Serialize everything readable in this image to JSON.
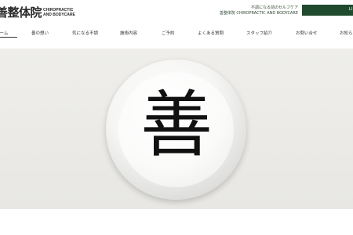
{
  "brand": {
    "name_jp": "善整体院",
    "name_en_line1": "CHIROPRACTIC",
    "name_en_line2": "AND BODYCARE"
  },
  "tagline": {
    "line1": "不調になる前のセルフケア",
    "line2": "善整体院 CHIROPRACTIC AND BODYCARE"
  },
  "cta": {
    "label": "LI"
  },
  "nav": {
    "items": [
      "ホーム",
      "善の想い",
      "気になる不調",
      "施術内容",
      "ご予約",
      "よくある質問",
      "スタッフ紹介",
      "お問い合せ",
      "お知ら"
    ],
    "active": "ホーム"
  },
  "hero": {
    "sign_text": "善"
  },
  "colors": {
    "accent": "#1f4a2e"
  }
}
